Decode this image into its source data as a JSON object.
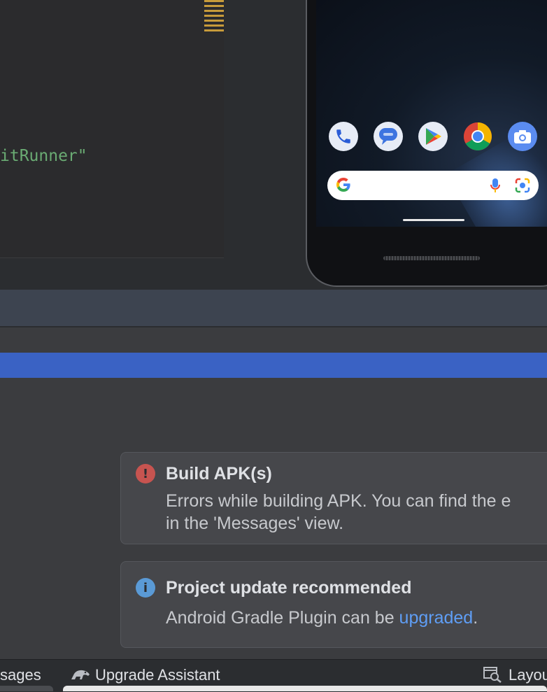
{
  "editor": {
    "code_fragment": "itRunner\""
  },
  "emulator": {
    "dock_apps": [
      "phone-app-icon",
      "messages-app-icon",
      "play-store-icon",
      "chrome-icon",
      "camera-icon"
    ],
    "search_icons": [
      "google-g-icon",
      "microphone-icon",
      "google-lens-icon"
    ]
  },
  "notifications": [
    {
      "type": "error",
      "icon_glyph": "!",
      "title": "Build APK(s)",
      "body_line1": "Errors while building APK. You can find the e",
      "body_line2": "in the 'Messages' view."
    },
    {
      "type": "info",
      "icon_glyph": "i",
      "title": "Project update recommended",
      "body_prefix": "Android Gradle Plugin can be ",
      "body_link": "upgraded",
      "body_suffix": "."
    }
  ],
  "bottom_tabs": {
    "messages_label": "sages",
    "upgrade_label": "Upgrade Assistant",
    "layout_label": "Layou"
  },
  "colors": {
    "error": "#c75450",
    "info": "#5a9ad6",
    "selection": "#3a62c4",
    "link": "#5f9ef5"
  }
}
